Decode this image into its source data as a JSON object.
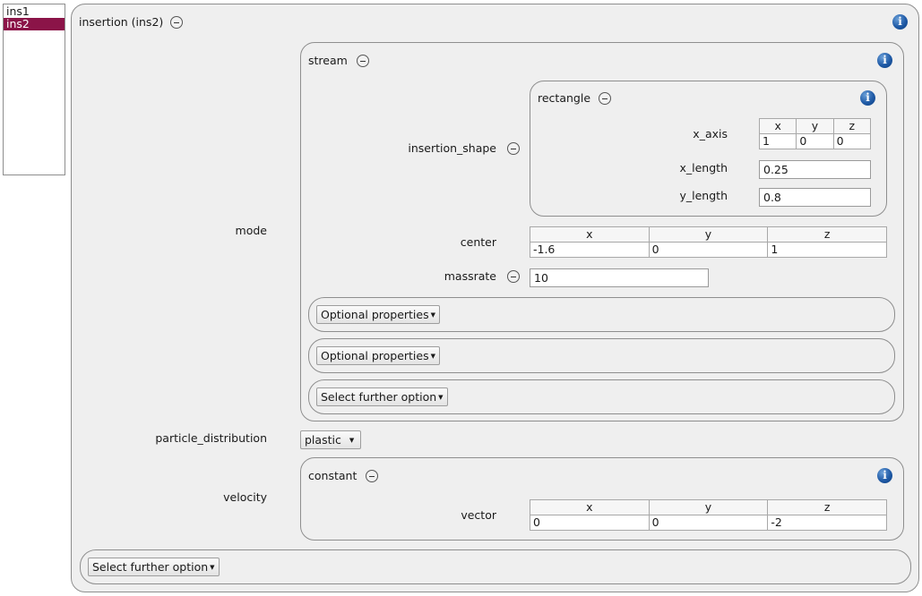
{
  "sidebar": {
    "items": [
      {
        "label": "ins1",
        "selected": false
      },
      {
        "label": "ins2",
        "selected": true
      }
    ],
    "selected_color": "#8b1448"
  },
  "insertion": {
    "title": "insertion (ins2)",
    "mode_label": "mode",
    "particle_distribution_label": "particle_distribution",
    "particle_distribution_value": "plastic",
    "velocity_label": "velocity",
    "select_further_label": "Select further option"
  },
  "stream": {
    "title": "stream",
    "insertion_shape_label": "insertion_shape",
    "center_label": "center",
    "center_headers": [
      "x",
      "y",
      "z"
    ],
    "center_values": [
      "-1.6",
      "0",
      "1"
    ],
    "massrate_label": "massrate",
    "massrate_value": "10",
    "optional_1": "Optional properties",
    "optional_2": "Optional properties",
    "select_further": "Select further option"
  },
  "rectangle": {
    "title": "rectangle",
    "x_axis_label": "x_axis",
    "x_axis_headers": [
      "x",
      "y",
      "z"
    ],
    "x_axis_values": [
      "1",
      "0",
      "0"
    ],
    "x_length_label": "x_length",
    "x_length_value": "0.25",
    "y_length_label": "y_length",
    "y_length_value": "0.8"
  },
  "velocity": {
    "title": "constant",
    "vector_label": "vector",
    "vector_headers": [
      "x",
      "y",
      "z"
    ],
    "vector_values": [
      "0",
      "0",
      "-2"
    ]
  },
  "icons": {
    "info": "info-icon",
    "remove": "minus-circle-icon",
    "dropdown": "dropdown-arrow-icon"
  },
  "colors": {
    "panel_bg": "#efefef",
    "info_blue": "#1f5aa6"
  }
}
